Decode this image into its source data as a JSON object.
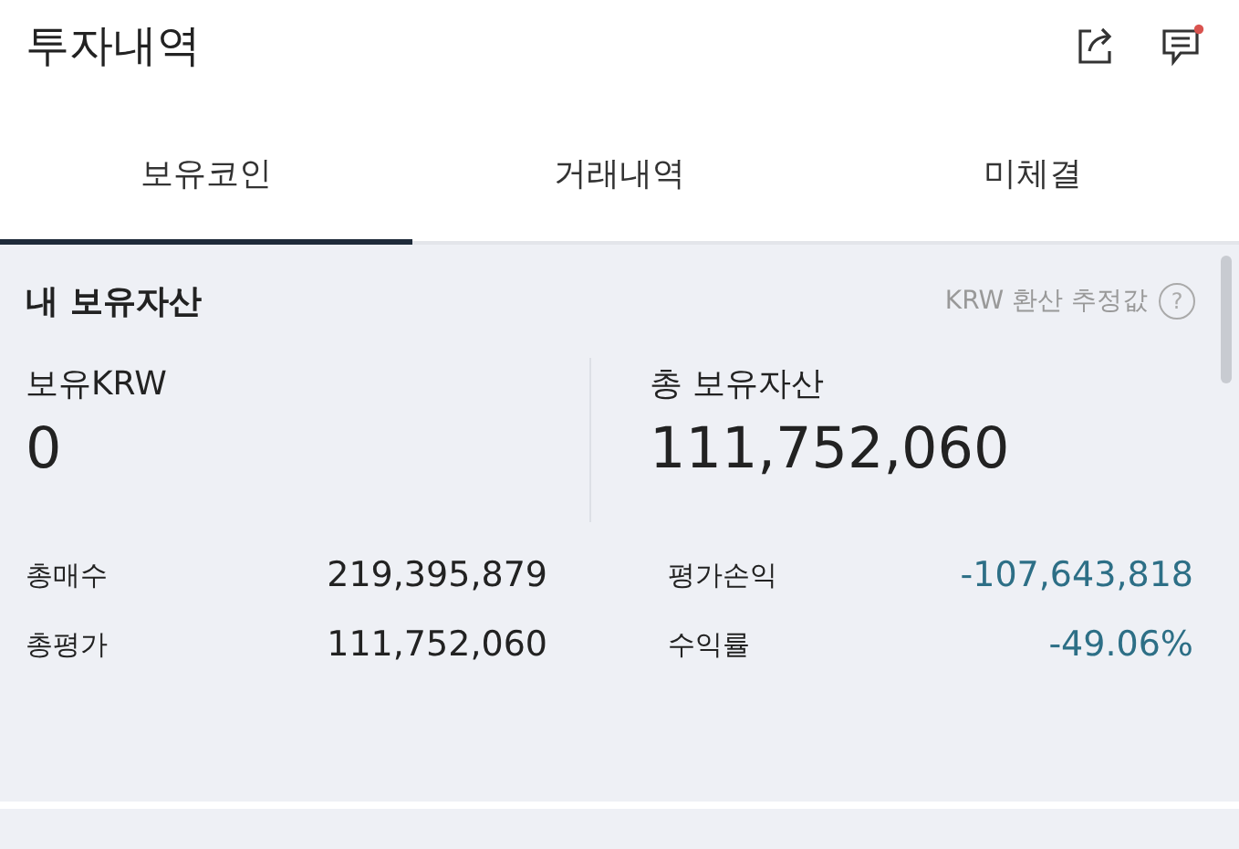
{
  "header": {
    "title": "투자내역"
  },
  "tabs": [
    {
      "label": "보유코인",
      "selected": true
    },
    {
      "label": "거래내역",
      "selected": false
    },
    {
      "label": "미체결",
      "selected": false
    }
  ],
  "assets": {
    "title": "내 보유자산",
    "note": "KRW 환산 추정값",
    "help_icon": "?",
    "summary": [
      {
        "label": "보유KRW",
        "value": "0"
      },
      {
        "label": "총 보유자산",
        "value": "111,752,060"
      }
    ],
    "stats": [
      {
        "label": "총매수",
        "value": "219,395,879",
        "kind": "plain"
      },
      {
        "label": "평가손익",
        "value": "-107,643,818",
        "kind": "negative"
      },
      {
        "label": "총평가",
        "value": "111,752,060",
        "kind": "plain"
      },
      {
        "label": "수익률",
        "value": "-49.06%",
        "kind": "negative"
      }
    ]
  }
}
